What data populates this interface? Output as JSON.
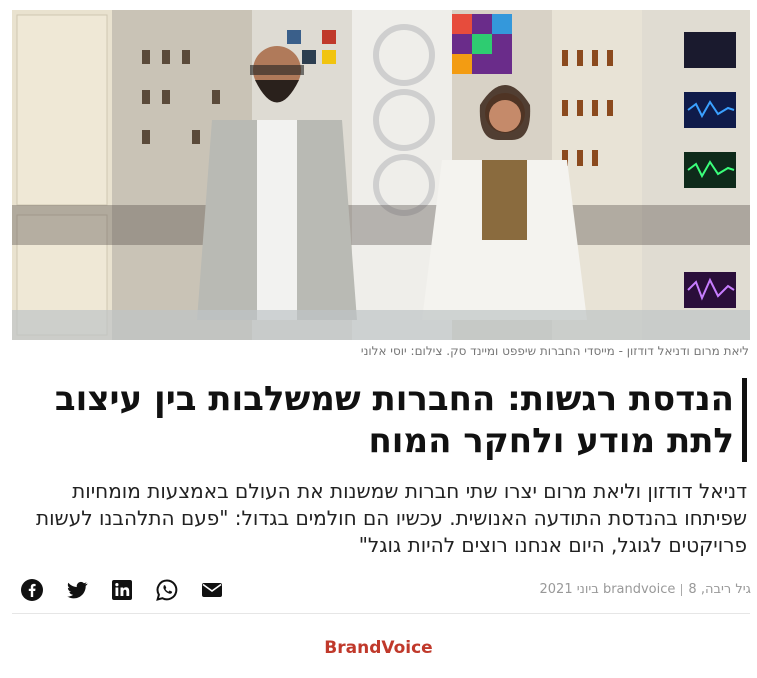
{
  "image": {
    "caption": "ליאת מרום ודניאל דודזון - מייסדי החברות שיפפט ומיינד סק. צילום: יוסי אלוני"
  },
  "article": {
    "title": "הנדסת רגשות: החברות שמשלבות בין עיצוב לתת מודע ולחקר המוח",
    "lede": "דניאל דודזון וליאת מרום יצרו שתי חברות שמשנות את העולם באמצעות מומחיות שפיתחו בהנדסת התודעה האנושית. עכשיו הם חולמים בגדול: \"פעם התלהבנו לעשות פרויקטים לגוגל, היום אנחנו רוצים להיות גוגל\"",
    "author": "גיל ריבה",
    "channel": "brandvoice",
    "date": "8 ביוני 2021"
  },
  "share": {
    "icons": [
      "facebook-icon",
      "twitter-icon",
      "linkedin-icon",
      "whatsapp-icon",
      "mail-icon"
    ]
  },
  "footer": {
    "brand_label": "BrandVoice"
  },
  "colors": {
    "brand_red": "#c0392b",
    "text_dark": "#111111",
    "meta_gray": "#999999"
  }
}
